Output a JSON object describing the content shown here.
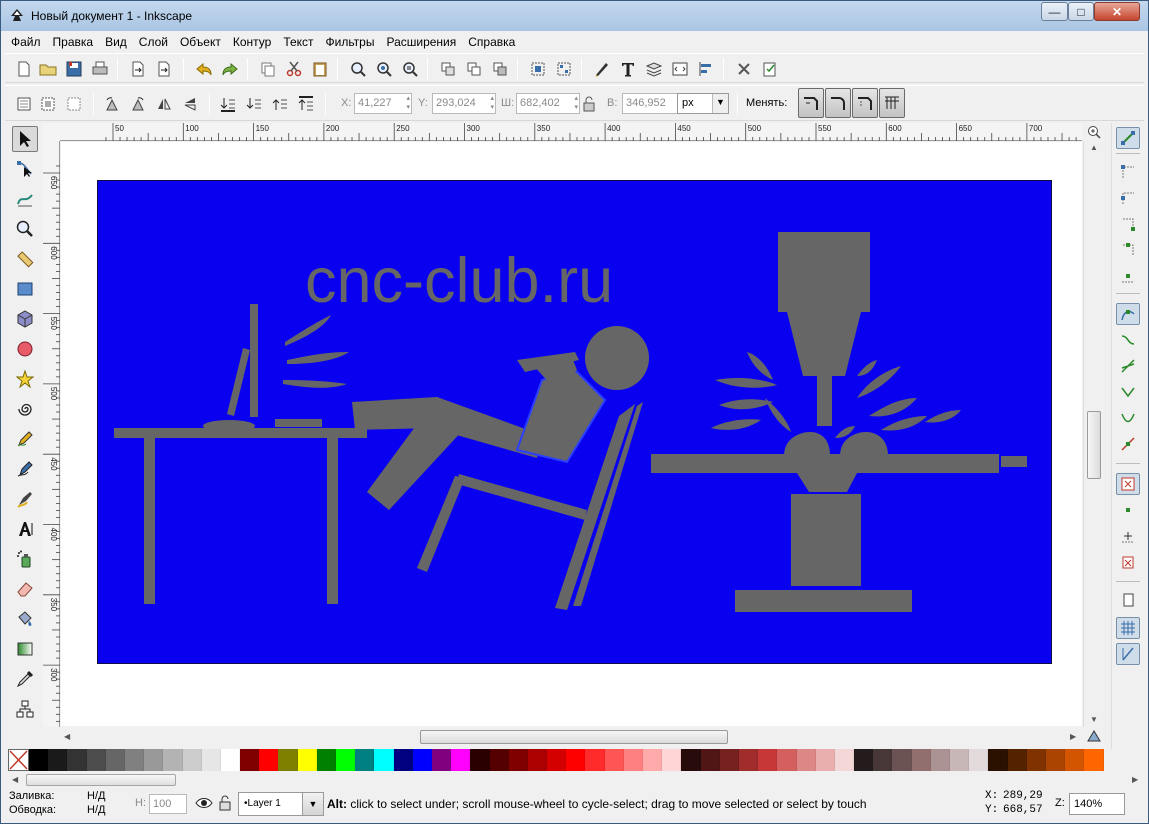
{
  "window": {
    "title": "Новый документ 1 - Inkscape",
    "buttons": {
      "minimize": "—",
      "maximize": "□",
      "close": "✕"
    }
  },
  "menu": {
    "items": [
      {
        "label": "Файл"
      },
      {
        "label": "Правка"
      },
      {
        "label": "Вид"
      },
      {
        "label": "Слой"
      },
      {
        "label": "Объект"
      },
      {
        "label": "Контур"
      },
      {
        "label": "Текст"
      },
      {
        "label": "Фильтры"
      },
      {
        "label": "Расширения"
      },
      {
        "label": "Справка"
      }
    ]
  },
  "controls": {
    "x": {
      "label": "X:",
      "value": "41,227"
    },
    "y": {
      "label": "Y:",
      "value": "293,024"
    },
    "w": {
      "label": "Ш:",
      "value": "682,402"
    },
    "h": {
      "label": "В:",
      "value": "346,952"
    },
    "unit": "px",
    "change_label": "Менять:"
  },
  "rulers": {
    "horizontal": [
      "50",
      "100",
      "150",
      "200",
      "250",
      "300",
      "350",
      "400",
      "450",
      "500",
      "550",
      "600",
      "650",
      "700"
    ],
    "vertical": [
      "650",
      "600",
      "550",
      "500",
      "450",
      "400",
      "350",
      "300"
    ]
  },
  "drawing": {
    "background_color": "#0a00f0",
    "figure_color": "#666666",
    "text": "cnc-club.ru"
  },
  "palette": {
    "colors": [
      "#000000",
      "#1a1a1a",
      "#333333",
      "#4d4d4d",
      "#666666",
      "#808080",
      "#999999",
      "#b3b3b3",
      "#cccccc",
      "#e6e6e6",
      "#ffffff",
      "#800000",
      "#ff0000",
      "#808000",
      "#ffff00",
      "#008000",
      "#00ff00",
      "#008080",
      "#00ffff",
      "#000080",
      "#0000ff",
      "#800080",
      "#ff00ff",
      "#2b0000",
      "#550000",
      "#800000",
      "#aa0000",
      "#d40000",
      "#ff0000",
      "#ff2a2a",
      "#ff5555",
      "#ff8080",
      "#ffaaaa",
      "#ffd5d5",
      "#280b0b",
      "#501616",
      "#782121",
      "#a02c2c",
      "#c83737",
      "#d35f5f",
      "#de8787",
      "#e9afaf",
      "#f4d7d7",
      "#241c1c",
      "#483737",
      "#6c5353",
      "#916f6f",
      "#ac9393",
      "#c8b7b7",
      "#e3dbdb",
      "#2b1100",
      "#552200",
      "#803300",
      "#aa4400",
      "#d45500",
      "#ff6600"
    ]
  },
  "status": {
    "fill_label": "Заливка:",
    "fill_value": "Н/Д",
    "stroke_label": "Обводка:",
    "stroke_value": "Н/Д",
    "opacity_label": "Н:",
    "opacity_value": "100",
    "layer": "•Layer 1",
    "message_bold": "Alt:",
    "message": " click to select under; scroll mouse-wheel to cycle-select; drag to move selected or select by touch",
    "cursor_x_label": "X:",
    "cursor_x": "289,29",
    "cursor_y_label": "Y:",
    "cursor_y": "668,57",
    "zoom_label": "Z:",
    "zoom": "140%"
  }
}
